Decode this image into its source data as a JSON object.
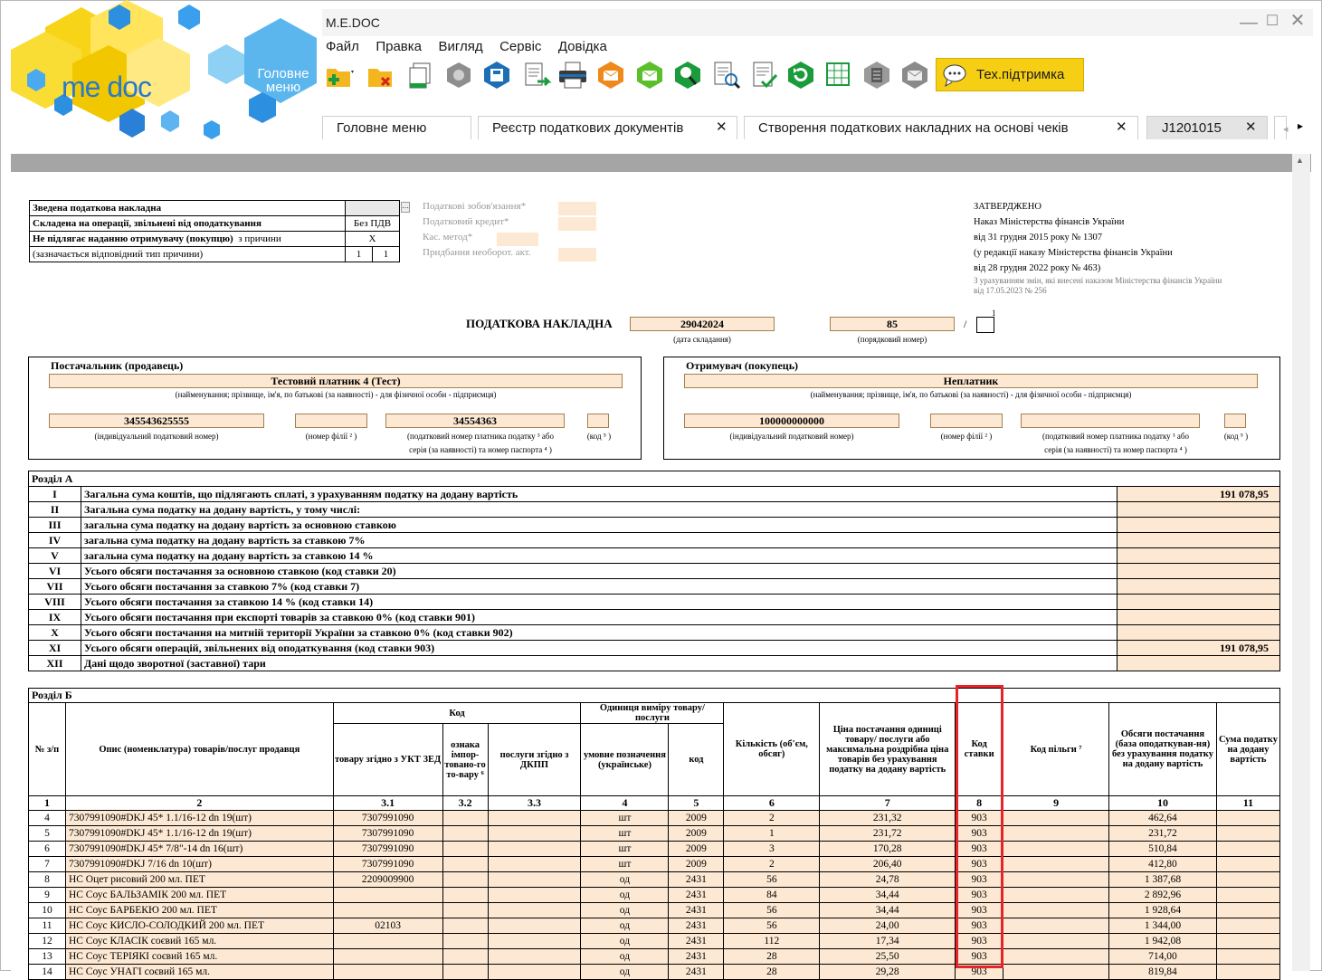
{
  "window": {
    "title": "M.E.DOC"
  },
  "logo": {
    "brand": "me doc",
    "main_menu": "Головне меню"
  },
  "menu": [
    "Файл",
    "Правка",
    "Вигляд",
    "Сервіс",
    "Довідка"
  ],
  "support_button": "Тех.підтримка",
  "tabs": [
    {
      "label": "Головне меню",
      "closable": false
    },
    {
      "label": "Реєстр податкових документів",
      "closable": true
    },
    {
      "label": "Створення податкових накладних на основі чеків",
      "closable": true
    },
    {
      "label": "J1201015",
      "closable": true
    }
  ],
  "doc": {
    "flags": {
      "r1": "Зведена податкова накладна",
      "r2": "Складена на операції, звільнені від оподаткування",
      "r2v": "Без ПДВ",
      "r3a": "Не підлягає наданню отримувачу (покупцю)",
      "r3b": "з причини",
      "r3v": "X",
      "r4": "(зазначається відповідний тип причини)",
      "r4v1": "1",
      "r4v2": "1"
    },
    "side_labels": [
      "Податкові зобов'язання*",
      "Податковий кредит*",
      "Кас. метод*",
      "Придбання необорот. акт."
    ],
    "approved": [
      "ЗАТВЕРДЖЕНО",
      "Наказ Міністерства фінансів України",
      "від 31 грудня 2015 року № 1307",
      "(у редакції наказу Міністерства фінансів України",
      "від 28 грудня 2022 року № 463)"
    ],
    "approved_note1": "З урахуванням змін, які внесені наказом Міністерства фінансів України",
    "approved_note2": "від 17.05.2023 № 256",
    "title": "ПОДАТКОВА НАКЛАДНА",
    "date": "29042024",
    "date_cap": "(дата складання)",
    "number": "85",
    "number_cap": "(порядковий номер)",
    "slash": "/",
    "sup1": "1",
    "seller": {
      "header": "Постачальник (продавець)",
      "name": "Тестовий платник 4 (Тест)",
      "ipn": "345543625555",
      "code": "34554363"
    },
    "buyer": {
      "header": "Отримувач (покупець)",
      "name": "Неплатник",
      "ipn": "100000000000",
      "code": ""
    },
    "caps": {
      "name": "(найменування; прізвище, ім'я, по батькові (за наявності) - для фізичної особи - підприємця)",
      "ipn": "(індивідуальний податковий номер)",
      "branch": "(номер філії ² )",
      "taxno": "(податковий номер платника податку ³ або",
      "passport": "серія (за наявності) та номер паспорта ⁴ )",
      "kod": "(код ⁵ )"
    },
    "sectionA": {
      "title": "Розділ А",
      "rows": [
        {
          "n": "I",
          "t": "Загальна сума коштів, що підлягають сплаті, з урахуванням податку на додану вартість",
          "v": "191 078,95"
        },
        {
          "n": "II",
          "t": "Загальна сума податку на додану вартість, у тому числі:",
          "v": ""
        },
        {
          "n": "III",
          "t": "загальна сума податку на додану вартість за основною ставкою",
          "v": ""
        },
        {
          "n": "IV",
          "t": "загальна сума податку на додану вартість за ставкою 7%",
          "v": ""
        },
        {
          "n": "V",
          "t": "загальна сума податку на додану вартість за ставкою 14 %",
          "v": ""
        },
        {
          "n": "VI",
          "t": "Усього обсяги постачання за основною ставкою (код ставки 20)",
          "v": ""
        },
        {
          "n": "VII",
          "t": "Усього обсяги постачання за ставкою 7% (код ставки 7)",
          "v": ""
        },
        {
          "n": "VIII",
          "t": "Усього обсяги постачання за ставкою 14 % (код ставки 14)",
          "v": ""
        },
        {
          "n": "IX",
          "t": "Усього обсяги постачання при експорті товарів за ставкою 0% (код ставки 901)",
          "v": ""
        },
        {
          "n": "X",
          "t": "Усього обсяги постачання на митній території України за ставкою 0% (код ставки 902)",
          "v": ""
        },
        {
          "n": "XI",
          "t": "Усього обсяги операцій, звільнених від оподаткування (код ставки 903)",
          "v": "191 078,95"
        },
        {
          "n": "XII",
          "t": "Дані щодо зворотної (заставної) тари",
          "v": ""
        }
      ]
    },
    "sectionB": {
      "title": "Розділ Б",
      "h": {
        "num": "№ з/п",
        "desc": "Опис (номенклатура) товарів/послуг продавця",
        "kod": "Код",
        "ukt": "товару згідно з УКТ ЗЕД",
        "imp": "ознака імпор-товано-го то-вару ⁶",
        "dkpp": "послуги згідно з ДКПП",
        "unit": "Одиниця виміру товару/ послуги",
        "unit_name": "умовне позначення (українське)",
        "unit_code": "код",
        "qty": "Кількість (об'єм, обсяг)",
        "price": "Ціна постачання одиниці товару/ послуги або максимальна роздрібна ціна товарів без урахування податку на додану вартість",
        "rate": "Код ставки",
        "benefit": "Код пільги ⁷",
        "volume": "Обсяги постачання (база оподаткуван-ня) без урахування податку на додану вартість",
        "vat": "Сума податку на додану вартість"
      },
      "col_numbers": [
        "1",
        "2",
        "3.1",
        "3.2",
        "3.3",
        "4",
        "5",
        "6",
        "7",
        "8",
        "9",
        "10",
        "11"
      ],
      "rows": [
        {
          "n": "4",
          "d": "7307991090#DKJ 45* 1.1/16-12 dn 19(шт)",
          "ukt": "7307991090",
          "unit": "шт",
          "code": "2009",
          "qty": "2",
          "price": "231,32",
          "rate": "903",
          "vol": "462,64"
        },
        {
          "n": "5",
          "d": "7307991090#DKJ 45* 1.1/16-12 dn 19(шт)",
          "ukt": "7307991090",
          "unit": "шт",
          "code": "2009",
          "qty": "1",
          "price": "231,72",
          "rate": "903",
          "vol": "231,72"
        },
        {
          "n": "6",
          "d": "7307991090#DKJ 45* 7/8\"-14 dn 16(шт)",
          "ukt": "7307991090",
          "unit": "шт",
          "code": "2009",
          "qty": "3",
          "price": "170,28",
          "rate": "903",
          "vol": "510,84"
        },
        {
          "n": "7",
          "d": "7307991090#DKJ 7/16 dn 10(шт)",
          "ukt": "7307991090",
          "unit": "шт",
          "code": "2009",
          "qty": "2",
          "price": "206,40",
          "rate": "903",
          "vol": "412,80"
        },
        {
          "n": "8",
          "d": "НС Оцет рисовий 200 мл. ПЕТ",
          "ukt": "2209009900",
          "unit": "од",
          "code": "2431",
          "qty": "56",
          "price": "24,78",
          "rate": "903",
          "vol": "1 387,68"
        },
        {
          "n": "9",
          "d": "НС Соус БАЛЬЗАМІК 200 мл. ПЕТ",
          "ukt": "",
          "unit": "од",
          "code": "2431",
          "qty": "84",
          "price": "34,44",
          "rate": "903",
          "vol": "2 892,96"
        },
        {
          "n": "10",
          "d": "НС Соус БАРБЕКЮ 200 мл. ПЕТ",
          "ukt": "",
          "unit": "од",
          "code": "2431",
          "qty": "56",
          "price": "34,44",
          "rate": "903",
          "vol": "1 928,64"
        },
        {
          "n": "11",
          "d": "НС Соус КИСЛО-СОЛОДКИЙ 200 мл. ПЕТ",
          "ukt": "02103",
          "unit": "од",
          "code": "2431",
          "qty": "56",
          "price": "24,00",
          "rate": "903",
          "vol": "1 344,00"
        },
        {
          "n": "12",
          "d": "НС Соус КЛАСІК соєвий 165 мл.",
          "ukt": "",
          "unit": "од",
          "code": "2431",
          "qty": "112",
          "price": "17,34",
          "rate": "903",
          "vol": "1 942,08"
        },
        {
          "n": "13",
          "d": "НС Соус ТЕРІЯКІ соєвий 165 мл.",
          "ukt": "",
          "unit": "од",
          "code": "2431",
          "qty": "28",
          "price": "25,50",
          "rate": "903",
          "vol": "714,00"
        },
        {
          "n": "14",
          "d": "НС Соус УНАГІ соєвий 165 мл.",
          "ukt": "",
          "unit": "од",
          "code": "2431",
          "qty": "28",
          "price": "29,28",
          "rate": "903",
          "vol": "819,84"
        }
      ]
    }
  },
  "colors": {
    "fill": "#fde9d3",
    "highlight": "#e8232a",
    "support": "#f6cf14",
    "toolbar_green": "#1a9b3c"
  }
}
